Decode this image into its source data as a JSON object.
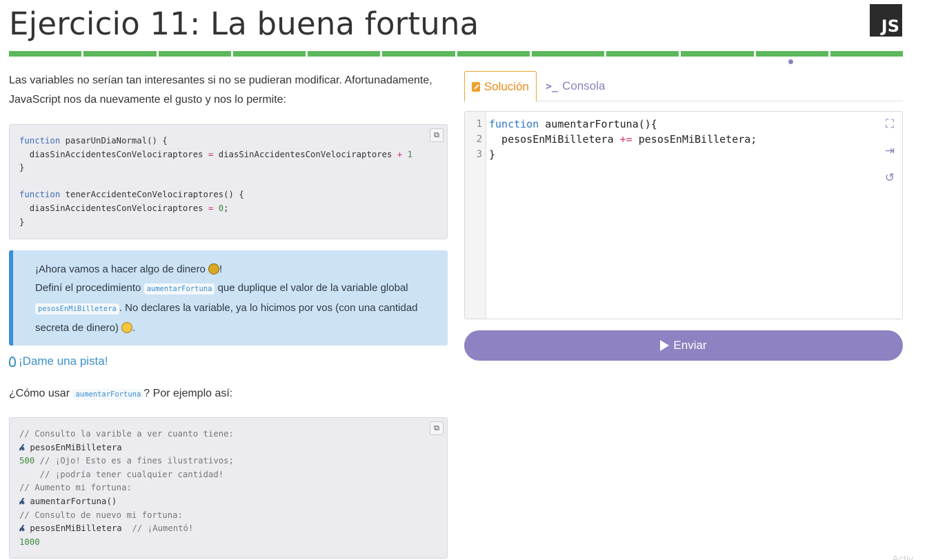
{
  "header": {
    "title": "Ejercicio 11: La buena fortuna",
    "language_badge": "JS",
    "progress_segments": 12,
    "progress_color": "#5cb85c"
  },
  "content": {
    "intro": "Las variables no serían tan interesantes si no se pudieran modificar. Afortunadamente, JavaScript nos da nuevamente el gusto y nos lo permite:",
    "example_code": {
      "l1_kw": "function",
      "l1_rest": " pasarUnDiaNormal() {",
      "l2_a": "  diasSinAccidentesConVelociraptores ",
      "l2_op1": "=",
      "l2_b": " diasSinAccidentesConVelociraptores ",
      "l2_op2": "+",
      "l2_num": " 1",
      "l3": "}",
      "l5_kw": "function",
      "l5_rest": " tenerAccidenteConVelociraptores() {",
      "l6_a": "  diasSinAccidentesConVelociraptores ",
      "l6_op": "=",
      "l6_num": " 0",
      "l6_end": ";",
      "l7": "}"
    },
    "task": {
      "line1": "¡Ahora vamos a hacer algo de dinero ",
      "line1_end": "!",
      "p2_a": "Definí el procedimiento ",
      "code1": "aumentarFortuna",
      "p2_b": " que duplique el valor de la variable global ",
      "code2": "pesosEnMiBilletera",
      "p2_c": ". No declares la variable, ya lo hicimos por vos (con una cantidad secreta de dinero) ",
      "p2_d": "."
    },
    "hint_label": "¡Dame una pista!",
    "howto_a": "¿Cómo usar ",
    "howto_code": "aumentarFortuna",
    "howto_b": "? Por ejemplo así:",
    "console_example": {
      "c1": "// Consulto la varible a ver cuanto tiene:",
      "p1": "pesosEnMiBilletera",
      "r1": "500",
      "r1_cm": " // ¡Ojo! Esto es a fines ilustrativos;",
      "c2": "    // ¡podría tener cualquier cantidad!",
      "c3": "// Aumento mi fortuna:",
      "p2": "aumentarFortuna()",
      "c4": "// Consulto de nuevo mi fortuna:",
      "p3": "pesosEnMiBilletera",
      "p3_cm": "  // ¡Aumentó!",
      "r2": "1000"
    }
  },
  "editor": {
    "tab_solution": "Solución",
    "tab_console": "Consola",
    "line_numbers": [
      "1",
      "2",
      "3"
    ],
    "l1_kw": "function",
    "l1_rest": " aumentarFortuna(){",
    "l2_a": "  pesosEnMiBilletera ",
    "l2_op": "+=",
    "l2_b": " pesosEnMiBilletera;",
    "l3": "}",
    "submit_label": "Enviar"
  },
  "watermark": "Activ"
}
